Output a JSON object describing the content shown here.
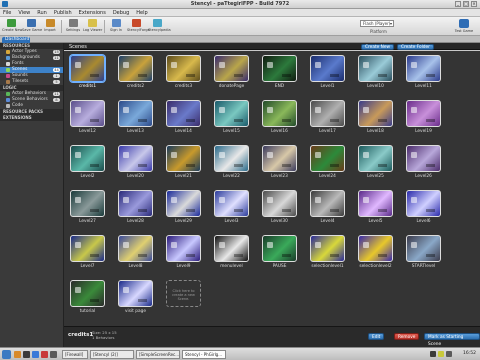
{
  "window": {
    "title": "Stencyl - paTtegirlFPP - Build 7972"
  },
  "menu": [
    "File",
    "View",
    "Run",
    "Publish",
    "Extensions",
    "Debug",
    "Help"
  ],
  "toolbar": {
    "buttons": [
      "Create New",
      "Save Game",
      "Import",
      "Settings",
      "Log Viewer",
      "Sign In",
      "StencylForge",
      "Stencylpedia"
    ],
    "account": "Flash (Player)",
    "platform": "Platform",
    "test_label": "Test Game"
  },
  "tabs": {
    "active": "Dashboard"
  },
  "sidebar": {
    "resources_header": "RESOURCES",
    "items": [
      {
        "label": "Actor Types",
        "count": "15"
      },
      {
        "label": "Backgrounds",
        "count": "11"
      },
      {
        "label": "Fonts",
        "count": ""
      },
      {
        "label": "Scenes",
        "count": "44"
      },
      {
        "label": "Sounds",
        "count": "1"
      },
      {
        "label": "Tilesets",
        "count": "5"
      }
    ],
    "logic_header": "LOGIC",
    "logic_items": [
      {
        "label": "Actor Behaviors",
        "count": "11"
      },
      {
        "label": "Scene Behaviors",
        "count": "8"
      },
      {
        "label": "Code",
        "count": ""
      }
    ],
    "resource_packs": "RESOURCE PACKS",
    "extensions": "EXTENSIONS"
  },
  "main": {
    "title": "Scenes",
    "create_new": "Create New",
    "create_folder": "Create Folder"
  },
  "scenes": [
    {
      "name": "credits1",
      "c1": "#2c3e8c",
      "c2": "#a98a2f"
    },
    {
      "name": "credits2",
      "c1": "#1d3f6a",
      "c2": "#c9a23b"
    },
    {
      "name": "credits3",
      "c1": "#5a4a1c",
      "c2": "#d8b94c"
    },
    {
      "name": "donatePage",
      "c1": "#3a2c6e",
      "c2": "#b9a64a"
    },
    {
      "name": "END",
      "c1": "#101a10",
      "c2": "#2c7a3c"
    },
    {
      "name": "Level1",
      "c1": "#1a2c6c",
      "c2": "#5a7acc"
    },
    {
      "name": "Level10",
      "c1": "#2a4e5c",
      "c2": "#9acbd8"
    },
    {
      "name": "Level11",
      "c1": "#2a3a8c",
      "c2": "#a8c2ea"
    },
    {
      "name": "Level12",
      "c1": "#5a4e8a",
      "c2": "#b8aede"
    },
    {
      "name": "Level13",
      "c1": "#2c4a8a",
      "c2": "#7aa9da"
    },
    {
      "name": "Level14",
      "c1": "#3a2c6a",
      "c2": "#6a7aca"
    },
    {
      "name": "Level15",
      "c1": "#1a5a6a",
      "c2": "#7ac8c0"
    },
    {
      "name": "Level16",
      "c1": "#224a2a",
      "c2": "#8ab85a"
    },
    {
      "name": "Level17",
      "c1": "#4a4a4a",
      "c2": "#b0b0b0"
    },
    {
      "name": "Level18",
      "c1": "#3a3c8a",
      "c2": "#c89a5a"
    },
    {
      "name": "Level19",
      "c1": "#6a2c8a",
      "c2": "#c890da"
    },
    {
      "name": "Level2",
      "c1": "#1a4a4a",
      "c2": "#5ab8a8"
    },
    {
      "name": "Level20",
      "c1": "#3a3aaa",
      "c2": "#c8c8ea"
    },
    {
      "name": "Level21",
      "c1": "#1a3a5a",
      "c2": "#c89a2c"
    },
    {
      "name": "Level22",
      "c1": "#2a6a8a",
      "c2": "#e8e8e8"
    },
    {
      "name": "Level23",
      "c1": "#3a3a5c",
      "c2": "#d8c8a8"
    },
    {
      "name": "Level24",
      "c1": "#6a3a1a",
      "c2": "#2c8a3a"
    },
    {
      "name": "Level25",
      "c1": "#1c5a5c",
      "c2": "#8acac8"
    },
    {
      "name": "Level26",
      "c1": "#4a2a6a",
      "c2": "#b8a8da"
    },
    {
      "name": "Level27",
      "c1": "#1a3a3a",
      "c2": "#8a9a9a"
    },
    {
      "name": "Level28",
      "c1": "#2a2a7a",
      "c2": "#9a9adc"
    },
    {
      "name": "Level29",
      "c1": "#1a2a9a",
      "c2": "#dadada"
    },
    {
      "name": "Level3",
      "c1": "#2c3c9c",
      "c2": "#e0e0ff"
    },
    {
      "name": "Level30",
      "c1": "#4a4a4a",
      "c2": "#d8d8d8"
    },
    {
      "name": "Level4",
      "c1": "#3a3a3a",
      "c2": "#bababa"
    },
    {
      "name": "Level5",
      "c1": "#5a2a8a",
      "c2": "#e0b8ff"
    },
    {
      "name": "Level6",
      "c1": "#2a2aaa",
      "c2": "#d0d0ff"
    },
    {
      "name": "Level7",
      "c1": "#1a2a8a",
      "c2": "#c8c84a"
    },
    {
      "name": "Level8",
      "c1": "#3a4a9a",
      "c2": "#e0d070"
    },
    {
      "name": "Level9",
      "c1": "#2a1a7a",
      "c2": "#c8c8ff"
    },
    {
      "name": "menulevel",
      "c1": "#101010",
      "c2": "#e8e8e8"
    },
    {
      "name": "PAUSE",
      "c1": "#1a3a2a",
      "c2": "#3aaa5a"
    },
    {
      "name": "selectionlevel1",
      "c1": "#2a2a9a",
      "c2": "#d8d83a"
    },
    {
      "name": "selectionlevel2",
      "c1": "#3a2aaa",
      "c2": "#e8c82a"
    },
    {
      "name": "STARTlevel",
      "c1": "#3a3a4a",
      "c2": "#8aa8c8"
    },
    {
      "name": "tutorial",
      "c1": "#2a2a2a",
      "c2": "#3a8a3a"
    },
    {
      "name": "visit page",
      "c1": "#1a2a8a",
      "c2": "#d8d8ff"
    }
  ],
  "placeholder_text": "Click here to create a new Scene.",
  "selection": {
    "name": "credits1",
    "info_line1": "Size: 25 x 15",
    "info_line2": "1 Behaviors",
    "edit": "Edit",
    "remove": "Remove",
    "mark_start": "Mark as Starting Scene"
  },
  "taskbar": {
    "tasks": [
      "[Firewall]",
      "[Stencyl (2)]",
      "[SimpleScreenRec...",
      "Stencyl - PhGirlg..."
    ],
    "clock": "16:52"
  }
}
